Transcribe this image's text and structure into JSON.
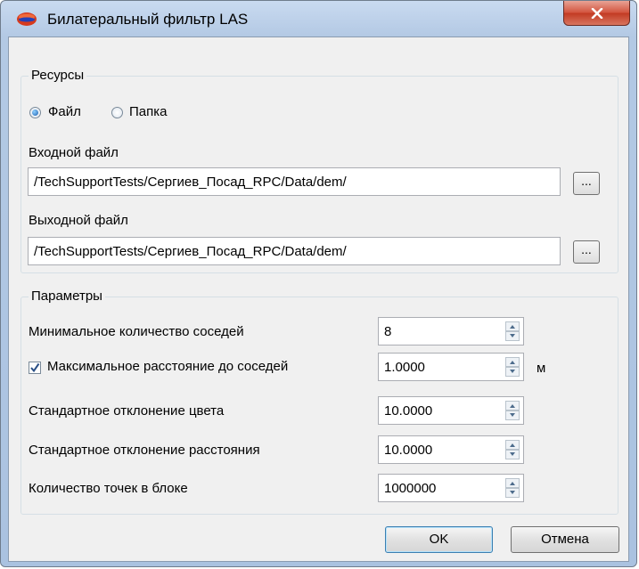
{
  "window": {
    "title": "Билатеральный фильтр LAS",
    "close_symbol": "x"
  },
  "resources": {
    "group_title": "Ресурсы",
    "mode_options": [
      {
        "label": "Файл",
        "selected": true
      },
      {
        "label": "Папка",
        "selected": false
      }
    ],
    "input_label": "Входной файл",
    "input_value": "/TechSupportTests/Сергиев_Посад_RPC/Data/dem/",
    "output_label": "Выходной файл",
    "output_value": "/TechSupportTests/Сергиев_Посад_RPC/Data/dem/",
    "browse_label": "..."
  },
  "params": {
    "group_title": "Параметры",
    "rows": [
      {
        "label": "Минимальное количество соседей",
        "value": "8",
        "unit": "",
        "has_checkbox": false
      },
      {
        "label": "Максимальное расстояние до соседей",
        "value": "1.0000",
        "unit": "м",
        "has_checkbox": true,
        "checked": true
      },
      {
        "label": "Стандартное отклонение цвета",
        "value": "10.0000",
        "unit": "",
        "has_checkbox": false
      },
      {
        "label": "Стандартное отклонение расстояния",
        "value": "10.0000",
        "unit": "",
        "has_checkbox": false
      },
      {
        "label": "Количество точек в блоке",
        "value": "1000000",
        "unit": "",
        "has_checkbox": false
      }
    ]
  },
  "buttons": {
    "ok": "OK",
    "cancel": "Отмена"
  }
}
